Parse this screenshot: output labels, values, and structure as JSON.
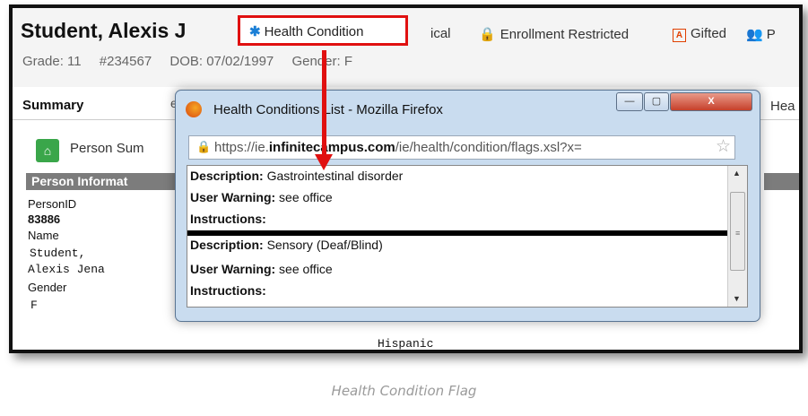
{
  "student": {
    "name": "Student, Alexis J",
    "grade": "Grade: 11",
    "id": "#234567",
    "dob": "DOB: 07/02/1997",
    "gender": "Gender: F"
  },
  "flags": {
    "health_condition": "Health Condition",
    "ical": "ical",
    "enrollment_restricted": "Enrollment Restricted",
    "gifted": "Gifted",
    "partial": "P"
  },
  "tabs": {
    "summary": "Summary",
    "partial_tab": "en",
    "hea": "Hea"
  },
  "summary": {
    "label": "Person Sum",
    "section_title": "Person Informat",
    "person_id_label": "PersonID",
    "person_id_value": "83886",
    "name_label": "Name",
    "name_line1": "Student,",
    "name_line2": "Alexis Jena",
    "gender_label": "Gender",
    "gender_value": "F",
    "ethnicity_partial": "Hispanic"
  },
  "popup": {
    "title": "Health Conditions List - Mozilla Firefox",
    "url_prefix": "https://ie.",
    "url_bold": "infinitecampus.com",
    "url_suffix": "/ie/health/condition/flags.xsl?x=",
    "minimize": "—",
    "maximize": "▢",
    "close": "X",
    "conditions": [
      {
        "description_label": "Description:",
        "description": "Gastrointestinal disorder",
        "warning_label": "User Warning:",
        "warning": "see office",
        "instructions_label": "Instructions:"
      },
      {
        "description_label": "Description:",
        "description": "Sensory (Deaf/Blind)",
        "warning_label": "User Warning:",
        "warning": "see office",
        "instructions_label": "Instructions:"
      }
    ]
  },
  "caption": "Health Condition Flag",
  "colors": {
    "highlight": "#e01010",
    "health_icon": "#1a7fd6",
    "popup_frame": "#c9dcef"
  }
}
